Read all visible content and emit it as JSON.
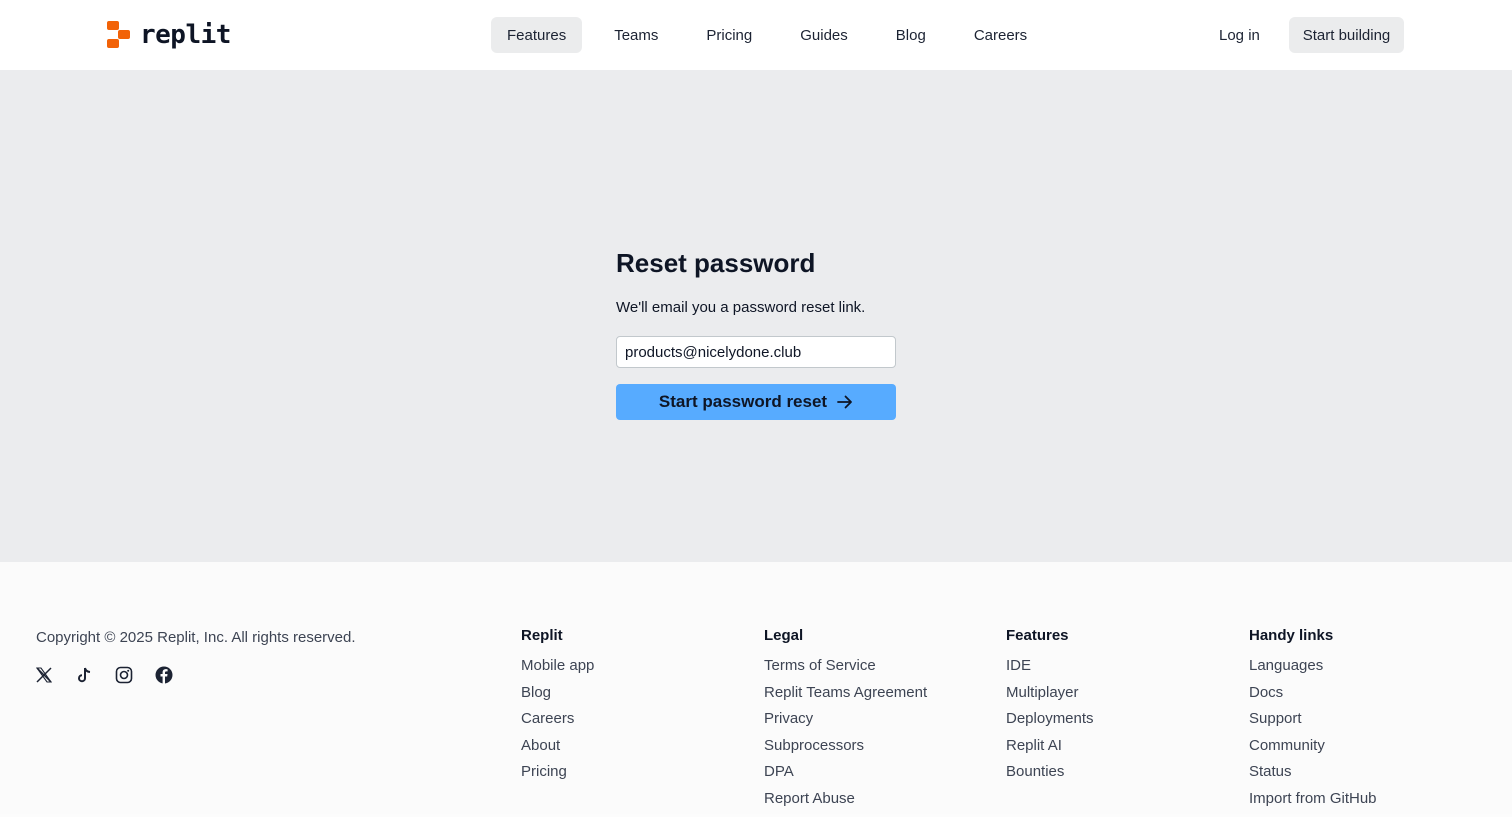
{
  "header": {
    "logo_text": "replit",
    "nav": [
      {
        "label": "Features",
        "active": true
      },
      {
        "label": "Teams"
      },
      {
        "label": "Pricing"
      },
      {
        "label": "Guides"
      },
      {
        "label": "Blog"
      },
      {
        "label": "Careers"
      }
    ],
    "login_label": "Log in",
    "start_label": "Start building"
  },
  "reset": {
    "title": "Reset password",
    "subtitle": "We'll email you a password reset link.",
    "email_value": "products@nicelydone.club",
    "button_label": "Start password reset"
  },
  "footer": {
    "copyright": "Copyright © 2025 Replit, Inc. All rights reserved.",
    "socials": [
      "x-icon",
      "tiktok-icon",
      "instagram-icon",
      "facebook-icon"
    ],
    "columns": [
      {
        "title": "Replit",
        "links": [
          "Mobile app",
          "Blog",
          "Careers",
          "About",
          "Pricing"
        ]
      },
      {
        "title": "Legal",
        "links": [
          "Terms of Service",
          "Replit Teams Agreement",
          "Privacy",
          "Subprocessors",
          "DPA",
          "Report Abuse"
        ]
      },
      {
        "title": "Features",
        "links": [
          "IDE",
          "Multiplayer",
          "Deployments",
          "Replit AI",
          "Bounties"
        ]
      },
      {
        "title": "Handy links",
        "links": [
          "Languages",
          "Docs",
          "Support",
          "Community",
          "Status",
          "Import from GitHub"
        ]
      }
    ]
  },
  "colors": {
    "brand": "#f26207",
    "accent": "#57abff",
    "main_bg": "#ebecee"
  }
}
